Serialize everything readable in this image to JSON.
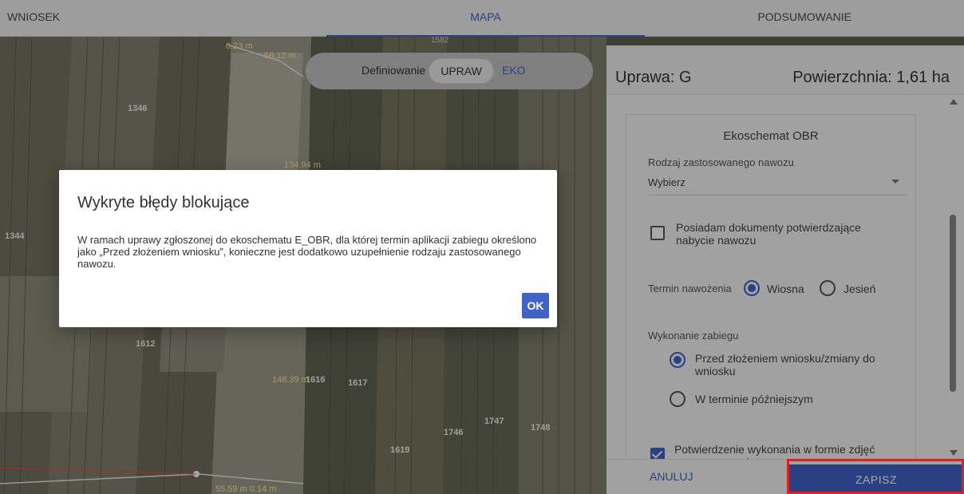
{
  "tabs": [
    {
      "label": "WNIOSEK",
      "active": false
    },
    {
      "label": "MAPA",
      "active": true
    },
    {
      "label": "PODSUMOWANIE",
      "active": false
    }
  ],
  "map": {
    "mode_label": "Definiowanie",
    "mode_options": [
      "UPRAW",
      "EKO"
    ],
    "selected_mode": "UPRAW",
    "parcel_labels": [
      "1346",
      "1344",
      "1612",
      "1616",
      "1617",
      "1619",
      "1746",
      "1747",
      "1748",
      "1582"
    ],
    "measurements": [
      "0.23 m",
      "56.12 m",
      "134.94 m",
      "148.39 m",
      "55.59 m 0.14 m"
    ]
  },
  "panel": {
    "crop_label": "Uprawa: G",
    "area_label": "Powierzchnia: 1,61 ha",
    "card_title": "Ekoschemat OBR",
    "fertilizer_label": "Rodzaj zastosowanego nawozu",
    "fertilizer_value": "Wybierz",
    "documents_checkbox": "Posiadam dokumenty potwierdzające nabycie nawozu",
    "documents_checked": false,
    "fertilization_term_label": "Termin nawożenia",
    "term_options": [
      "Wiosna",
      "Jesień"
    ],
    "term_selected": "Wiosna",
    "execution_label": "Wykonanie zabiegu",
    "execution_options": [
      "Przed złożeniem wniosku/zmiany do wniosku",
      "W terminie późniejszym"
    ],
    "execution_selected": "Przed złożeniem wniosku/zmiany do wniosku",
    "photo_checkbox": "Potwierdzenie wykonania w formie zdjęć geotagowanych",
    "photo_checked": true,
    "cancel_label": "ANULUJ",
    "save_label": "ZAPISZ"
  },
  "dialog": {
    "title": "Wykryte błędy blokujące",
    "message": "W ramach uprawy zgłoszonej do ekoschematu E_OBR, dla której termin aplikacji zabiegu określono jako „Przed złożeniem wniosku”, konieczne jest dodatkowo uzupełnienie rodzaju zastosowanego nawozu.",
    "ok_label": "OK"
  },
  "colors": {
    "accent": "#3f63c8",
    "highlight": "#e02020"
  }
}
